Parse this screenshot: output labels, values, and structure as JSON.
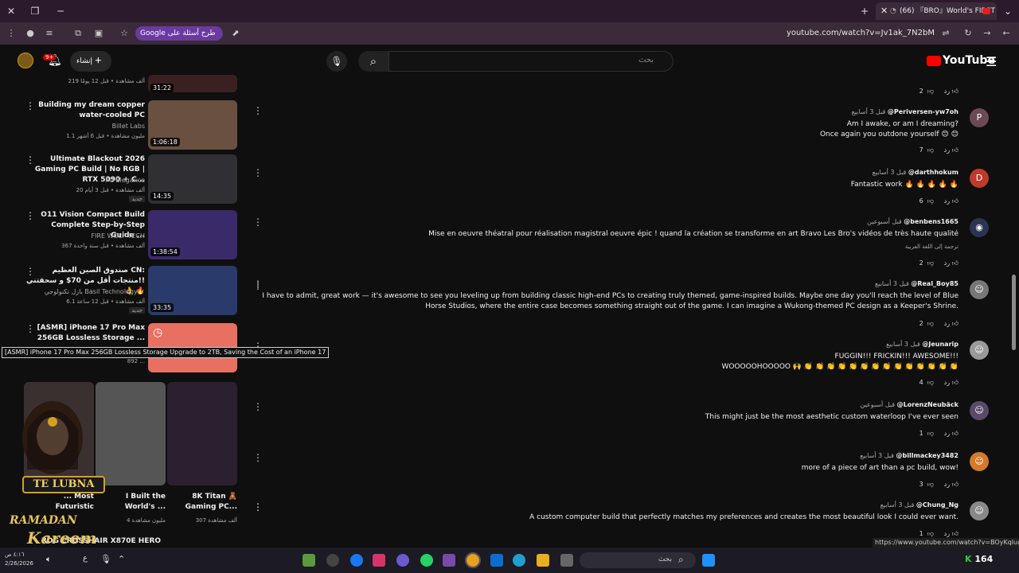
{
  "browser": {
    "tab_title": "(66) 『BRO』World's FIRST 9",
    "url": "youtube.com/watch?v=Jv1ak_7N2bM",
    "google_pill": "Google طرح أسئلة على"
  },
  "youtube": {
    "logo": "YouTube",
    "search_placeholder": "بحث",
    "create_label": "إنشاء",
    "notif_count": "9+"
  },
  "sidebar": {
    "top_meta": "219 ألف مشاهدة • قبل 12 يومًا",
    "top_duration": "31:22",
    "videos": [
      {
        "title": "Building my dream copper water-cooled PC",
        "channel": "Billet Labs",
        "meta": "1.1 مليون مشاهدة • قبل 6 أشهر",
        "duration": "1:06:18",
        "badge": ""
      },
      {
        "title": "Ultimate Blackout 2026 Gaming PC Build | No RGB | RTX 5090 + C...",
        "channel": "PC Elegance",
        "meta": "20 ألف مشاهدة • قبل 3 أيام",
        "duration": "14:35",
        "badge": "جديد"
      },
      {
        "title": "O11 Vision Compact Build Complete Step-by-Step Guide ...",
        "channel": "FIRE WOLF TECH",
        "meta": "367 ألف مشاهدة • قبل سنة واحدة",
        "duration": "1:38:54",
        "badge": ""
      },
      {
        "title": "صندوق الصين العظيم CN: منتجات أقل من 70$ و سحقتني!! 👌 🔥",
        "channel": "بازل تكنولوجي Basil Technology ✓",
        "meta": "6.1 ألف مشاهدة • قبل 12 ساعة",
        "duration": "33:35",
        "badge": "جديد"
      },
      {
        "title": "[ASMR] iPhone 17 Pro Max 256GB Lossless Storage ...",
        "channel": "",
        "meta": "892 ...",
        "duration": "",
        "badge": ""
      }
    ],
    "tooltip": "[ASMR] iPhone 17 Pro Max 256GB Lossless Storage Upgrade to 2TB, Saving the Cost of an iPhone 17",
    "shorts": [
      {
        "title": "8K Titan 🧸 Gaming PC...",
        "meta": "307 ألف مشاهدة"
      },
      {
        "title": "I Built the World's ...",
        "meta": "4 مليون مشاهدة"
      },
      {
        "title": "... Most Futuristic",
        "meta": ""
      }
    ],
    "bottom_title": "ROG CROSSHAIR X870E HERO"
  },
  "overlay": {
    "name": "TE LUBNA",
    "line1": "RAMADAN",
    "line2": "Kareem"
  },
  "comments": [
    {
      "author": "@Periversen-yw7oh",
      "time": "قبل 3 أسابيع",
      "initial": "P",
      "color": "#6b4a55",
      "text": "Am I awake, or am I dreaming?\nOnce again you outdone yourself 😊 😊",
      "likes": "7",
      "reply": "رد",
      "translate": ""
    },
    {
      "author": "@darthhokum",
      "time": "قبل 3 أسابيع",
      "initial": "D",
      "color": "#c0392b",
      "text": "Fantastic work 🔥 🔥 🔥 🔥 🔥",
      "likes": "6",
      "reply": "رد",
      "translate": ""
    },
    {
      "author": "@benbens1665",
      "time": "قبل أسبوعين",
      "initial": "",
      "color": "#2a3550",
      "text": "Mise en oeuvre théatral pour réalisation magistral oeuvre épic ! quand la création se transforme en art Bravo Les Bro's vidéos de très haute qualité",
      "likes": "2",
      "reply": "رد",
      "translate": "ترجمة إلى اللغة العربية"
    },
    {
      "author": "@Real_Boy85",
      "time": "قبل 3 أسابيع",
      "initial": "",
      "color": "#777",
      "text": "I have to admit, great work — it's awesome to see you leveling up from building classic high-end PCs to creating truly themed, game-inspired builds. Maybe one day you'll reach the level of Blue Horse Studios, where the entire case becomes something straight out of the game. I can imagine a Wukong-themed PC design as a Keeper's Shrine.",
      "likes": "2",
      "reply": "رد",
      "translate": ""
    },
    {
      "author": "@Jeunarip",
      "time": "قبل 3 أسابيع",
      "initial": "",
      "color": "#999",
      "text": "FUGGIN!!! FRICKIN!!! AWESOME!!!\nWOOOOOHOOOOO 🙌 👏 👏 👏 👏 👏 👏 👏 👏 👏 👏 👏 👏 👏 👏",
      "likes": "4",
      "reply": "رد",
      "translate": ""
    },
    {
      "author": "@LorenzNeubäck",
      "time": "قبل أسبوعين",
      "initial": "",
      "color": "#5a4a6a",
      "text": "This might just be the most aesthetic custom waterloop I've ever seen",
      "likes": "1",
      "reply": "رد",
      "translate": ""
    },
    {
      "author": "@billmackey3482",
      "time": "قبل 3 أسابيع",
      "initial": "",
      "color": "#d47a2a",
      "text": "more of a piece of art than a pc build, wow!",
      "likes": "3",
      "reply": "رد",
      "translate": ""
    },
    {
      "author": "@Chung_Ng",
      "time": "قبل 3 أسابيع",
      "initial": "",
      "color": "#888",
      "text": "A custom computer build that perfectly matches my preferences and creates the most beautiful look I could ever want.",
      "likes": "1",
      "reply": "رد",
      "translate": ""
    }
  ],
  "first_reply_likes": "2",
  "first_reply": "رد",
  "status_url": "https://www.youtube.com/watch?v=BOyKqIugNVE",
  "taskbar": {
    "search": "بحث",
    "clock_time": "٤:١٦ ص",
    "clock_date": "2/26/2026",
    "right_count": "164"
  }
}
